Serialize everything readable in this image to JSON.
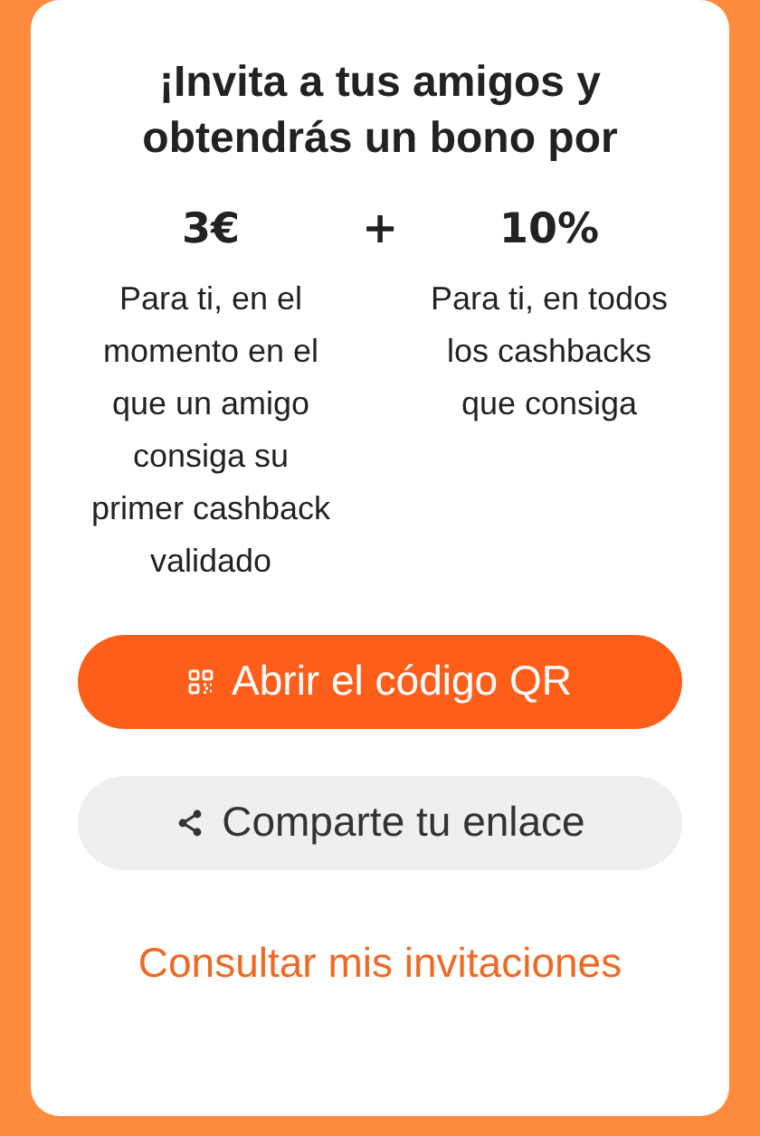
{
  "title": "¡Invita a tus amigos y obtendrás un bono por",
  "bonuses": [
    {
      "amount": "3€",
      "description": "Para ti, en el momento en el que un amigo consiga su primer cashback validado"
    },
    {
      "amount": "10%",
      "description": "Para ti, en todos los cashbacks que consiga"
    }
  ],
  "separator": "+",
  "buttons": [
    {
      "kind": "primary",
      "label": "Abrir el código QR"
    },
    {
      "kind": "secondary",
      "label": "Comparte tu enlace"
    }
  ],
  "link": "Consultar mis invitaciones"
}
